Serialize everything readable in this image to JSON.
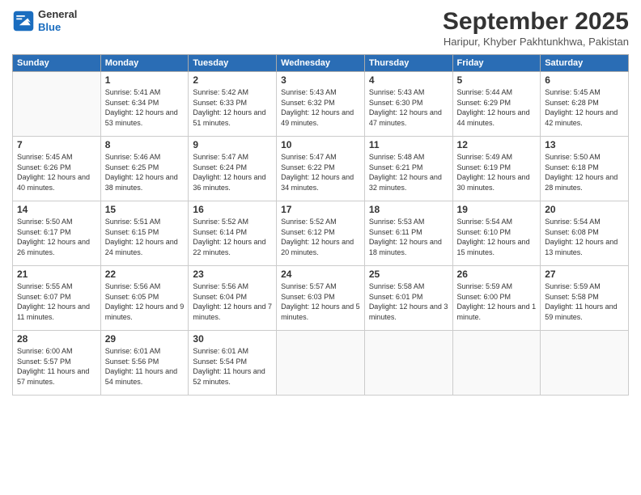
{
  "logo": {
    "line1": "General",
    "line2": "Blue"
  },
  "title": "September 2025",
  "location": "Haripur, Khyber Pakhtunkhwa, Pakistan",
  "days_header": [
    "Sunday",
    "Monday",
    "Tuesday",
    "Wednesday",
    "Thursday",
    "Friday",
    "Saturday"
  ],
  "weeks": [
    [
      {
        "day": "",
        "info": ""
      },
      {
        "day": "1",
        "info": "Sunrise: 5:41 AM\nSunset: 6:34 PM\nDaylight: 12 hours\nand 53 minutes."
      },
      {
        "day": "2",
        "info": "Sunrise: 5:42 AM\nSunset: 6:33 PM\nDaylight: 12 hours\nand 51 minutes."
      },
      {
        "day": "3",
        "info": "Sunrise: 5:43 AM\nSunset: 6:32 PM\nDaylight: 12 hours\nand 49 minutes."
      },
      {
        "day": "4",
        "info": "Sunrise: 5:43 AM\nSunset: 6:30 PM\nDaylight: 12 hours\nand 47 minutes."
      },
      {
        "day": "5",
        "info": "Sunrise: 5:44 AM\nSunset: 6:29 PM\nDaylight: 12 hours\nand 44 minutes."
      },
      {
        "day": "6",
        "info": "Sunrise: 5:45 AM\nSunset: 6:28 PM\nDaylight: 12 hours\nand 42 minutes."
      }
    ],
    [
      {
        "day": "7",
        "info": "Sunrise: 5:45 AM\nSunset: 6:26 PM\nDaylight: 12 hours\nand 40 minutes."
      },
      {
        "day": "8",
        "info": "Sunrise: 5:46 AM\nSunset: 6:25 PM\nDaylight: 12 hours\nand 38 minutes."
      },
      {
        "day": "9",
        "info": "Sunrise: 5:47 AM\nSunset: 6:24 PM\nDaylight: 12 hours\nand 36 minutes."
      },
      {
        "day": "10",
        "info": "Sunrise: 5:47 AM\nSunset: 6:22 PM\nDaylight: 12 hours\nand 34 minutes."
      },
      {
        "day": "11",
        "info": "Sunrise: 5:48 AM\nSunset: 6:21 PM\nDaylight: 12 hours\nand 32 minutes."
      },
      {
        "day": "12",
        "info": "Sunrise: 5:49 AM\nSunset: 6:19 PM\nDaylight: 12 hours\nand 30 minutes."
      },
      {
        "day": "13",
        "info": "Sunrise: 5:50 AM\nSunset: 6:18 PM\nDaylight: 12 hours\nand 28 minutes."
      }
    ],
    [
      {
        "day": "14",
        "info": "Sunrise: 5:50 AM\nSunset: 6:17 PM\nDaylight: 12 hours\nand 26 minutes."
      },
      {
        "day": "15",
        "info": "Sunrise: 5:51 AM\nSunset: 6:15 PM\nDaylight: 12 hours\nand 24 minutes."
      },
      {
        "day": "16",
        "info": "Sunrise: 5:52 AM\nSunset: 6:14 PM\nDaylight: 12 hours\nand 22 minutes."
      },
      {
        "day": "17",
        "info": "Sunrise: 5:52 AM\nSunset: 6:12 PM\nDaylight: 12 hours\nand 20 minutes."
      },
      {
        "day": "18",
        "info": "Sunrise: 5:53 AM\nSunset: 6:11 PM\nDaylight: 12 hours\nand 18 minutes."
      },
      {
        "day": "19",
        "info": "Sunrise: 5:54 AM\nSunset: 6:10 PM\nDaylight: 12 hours\nand 15 minutes."
      },
      {
        "day": "20",
        "info": "Sunrise: 5:54 AM\nSunset: 6:08 PM\nDaylight: 12 hours\nand 13 minutes."
      }
    ],
    [
      {
        "day": "21",
        "info": "Sunrise: 5:55 AM\nSunset: 6:07 PM\nDaylight: 12 hours\nand 11 minutes."
      },
      {
        "day": "22",
        "info": "Sunrise: 5:56 AM\nSunset: 6:05 PM\nDaylight: 12 hours\nand 9 minutes."
      },
      {
        "day": "23",
        "info": "Sunrise: 5:56 AM\nSunset: 6:04 PM\nDaylight: 12 hours\nand 7 minutes."
      },
      {
        "day": "24",
        "info": "Sunrise: 5:57 AM\nSunset: 6:03 PM\nDaylight: 12 hours\nand 5 minutes."
      },
      {
        "day": "25",
        "info": "Sunrise: 5:58 AM\nSunset: 6:01 PM\nDaylight: 12 hours\nand 3 minutes."
      },
      {
        "day": "26",
        "info": "Sunrise: 5:59 AM\nSunset: 6:00 PM\nDaylight: 12 hours\nand 1 minute."
      },
      {
        "day": "27",
        "info": "Sunrise: 5:59 AM\nSunset: 5:58 PM\nDaylight: 11 hours\nand 59 minutes."
      }
    ],
    [
      {
        "day": "28",
        "info": "Sunrise: 6:00 AM\nSunset: 5:57 PM\nDaylight: 11 hours\nand 57 minutes."
      },
      {
        "day": "29",
        "info": "Sunrise: 6:01 AM\nSunset: 5:56 PM\nDaylight: 11 hours\nand 54 minutes."
      },
      {
        "day": "30",
        "info": "Sunrise: 6:01 AM\nSunset: 5:54 PM\nDaylight: 11 hours\nand 52 minutes."
      },
      {
        "day": "",
        "info": ""
      },
      {
        "day": "",
        "info": ""
      },
      {
        "day": "",
        "info": ""
      },
      {
        "day": "",
        "info": ""
      }
    ]
  ]
}
